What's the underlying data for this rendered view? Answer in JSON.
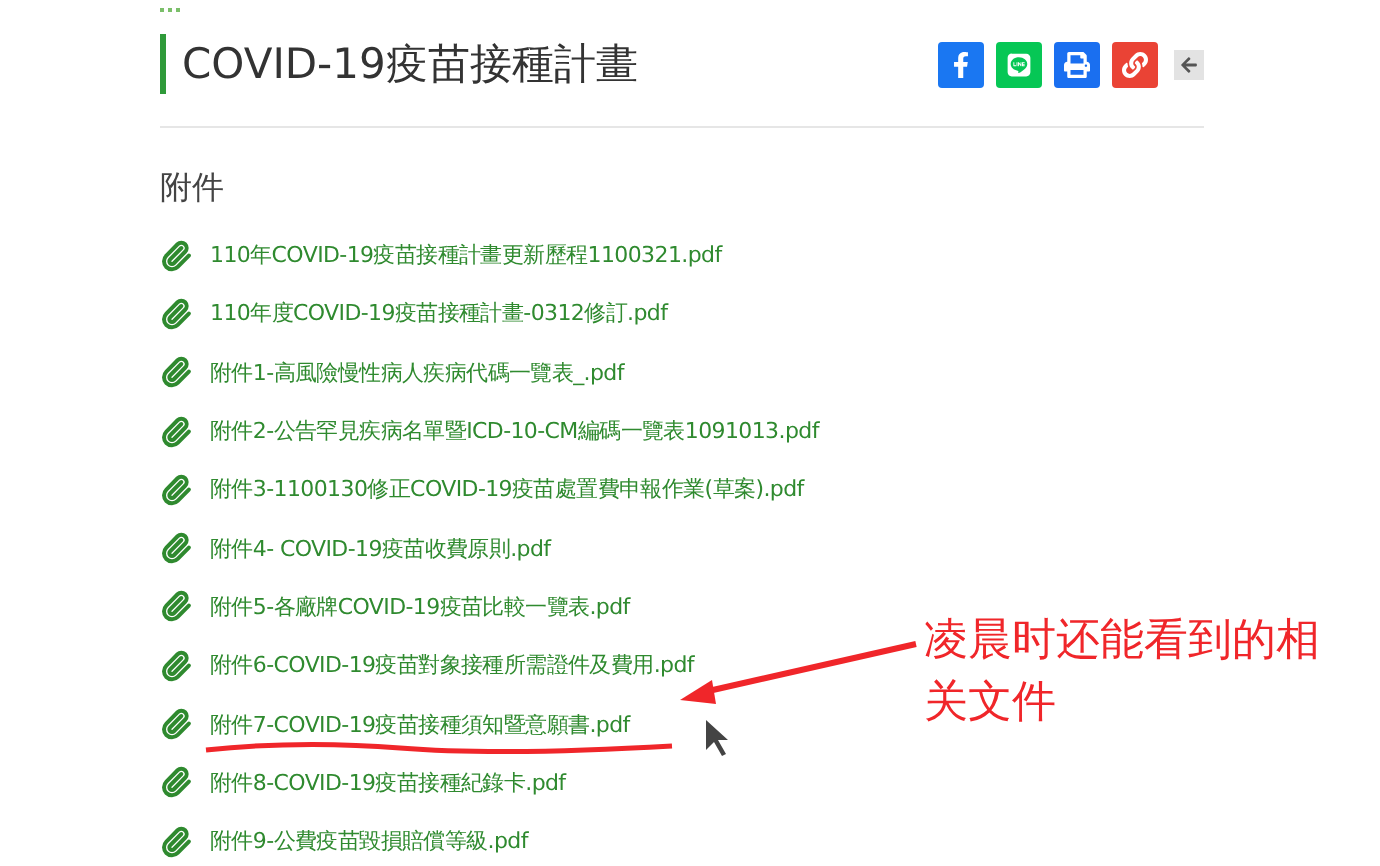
{
  "page": {
    "title": "COVID-19疫苗接種計畫"
  },
  "section": {
    "heading": "附件"
  },
  "attachments": [
    {
      "name": "110年COVID-19疫苗接種計畫更新歷程1100321.pdf"
    },
    {
      "name": "110年度COVID-19疫苗接種計畫-0312修訂.pdf"
    },
    {
      "name": "附件1-高風險慢性病人疾病代碼一覽表_.pdf"
    },
    {
      "name": "附件2-公告罕見疾病名單暨ICD-10-CM編碼一覽表1091013.pdf"
    },
    {
      "name": "附件3-1100130修正COVID-19疫苗處置費申報作業(草案).pdf"
    },
    {
      "name": "附件4- COVID-19疫苗收費原則.pdf"
    },
    {
      "name": "附件5-各廠牌COVID-19疫苗比較一覽表.pdf"
    },
    {
      "name": "附件6-COVID-19疫苗對象接種所需證件及費用.pdf"
    },
    {
      "name": "附件7-COVID-19疫苗接種須知暨意願書.pdf"
    },
    {
      "name": "附件8-COVID-19疫苗接種紀錄卡.pdf"
    },
    {
      "name": "附件9-公費疫苗毀損賠償等級.pdf"
    }
  ],
  "annotation": {
    "text": "凌晨时还能看到的相关文件"
  }
}
